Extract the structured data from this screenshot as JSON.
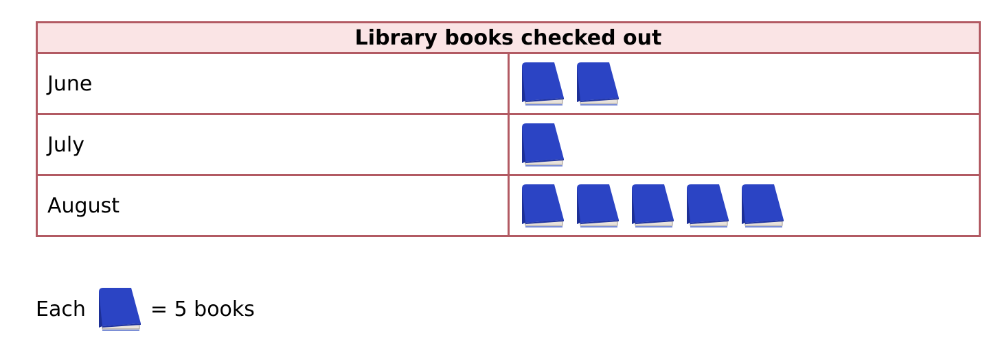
{
  "chart_data": {
    "type": "table",
    "title": "Library books checked out",
    "icon": "book-icon",
    "icon_color": "#2b44c4",
    "categories": [
      "June",
      "July",
      "August"
    ],
    "icon_counts": [
      2,
      1,
      5
    ],
    "rows": [
      {
        "label": "June",
        "icons": 2
      },
      {
        "label": "July",
        "icons": 1
      },
      {
        "label": "August",
        "icons": 5
      }
    ],
    "key": {
      "prefix": "Each",
      "suffix": "= 5 books",
      "books_per_icon": 5
    },
    "colors": {
      "border": "#b25a63",
      "header_background": "#fae4e5"
    }
  }
}
